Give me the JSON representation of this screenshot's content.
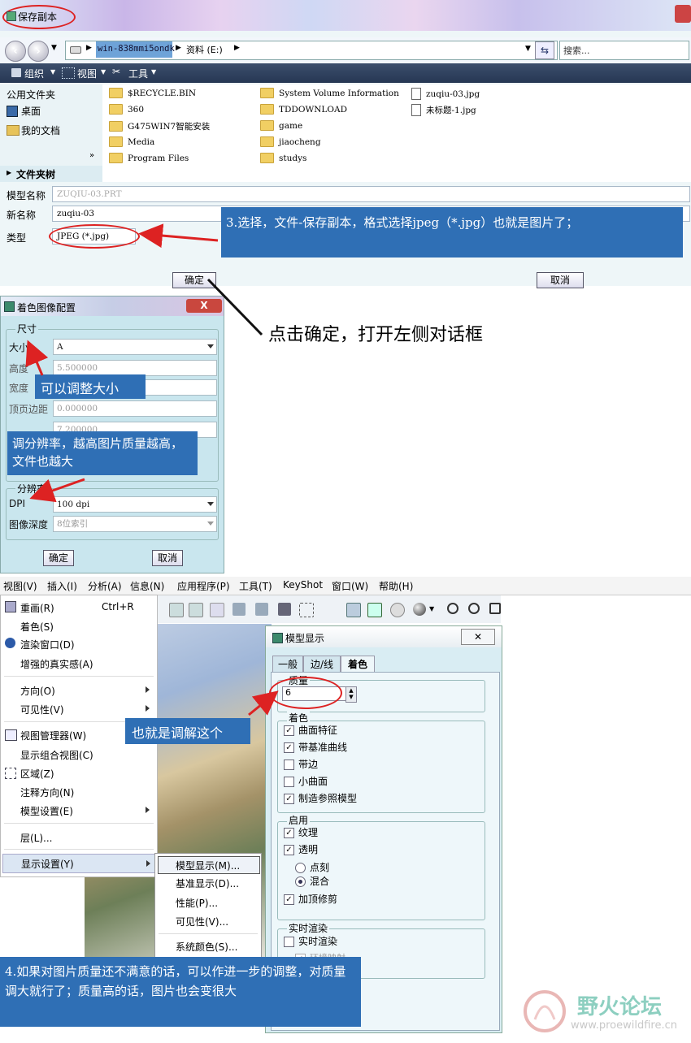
{
  "save_dialog": {
    "title": "保存副本",
    "address_host": "win-838mmi5ondk",
    "address_path": "资料 (E:)",
    "search_placeholder": "搜索...",
    "toolbar": {
      "organize": "组织",
      "view": "视图",
      "tools": "工具"
    },
    "left_pane": {
      "header": "公用文件夹",
      "items": [
        "桌面",
        "我的文档"
      ],
      "tree": "文件夹树"
    },
    "files": [
      {
        "name": "$RECYCLE.BIN",
        "kind": "folder"
      },
      {
        "name": "360",
        "kind": "folder"
      },
      {
        "name": "G475WIN7智能安装",
        "kind": "folder"
      },
      {
        "name": "Media",
        "kind": "folder"
      },
      {
        "name": "Program Files",
        "kind": "folder"
      },
      {
        "name": "System Volume Information",
        "kind": "folder"
      },
      {
        "name": "TDDOWNLOAD",
        "kind": "folder"
      },
      {
        "name": "game",
        "kind": "folder"
      },
      {
        "name": "jiaocheng",
        "kind": "folder"
      },
      {
        "name": "studys",
        "kind": "folder"
      },
      {
        "name": "zuqiu-03.jpg",
        "kind": "file"
      },
      {
        "name": "未标题-1.jpg",
        "kind": "file"
      }
    ],
    "fields": {
      "model_name_label": "模型名称",
      "model_name_value": "ZUQIU-03.PRT",
      "new_name_label": "新名称",
      "new_name_value": "zuqiu-03",
      "type_label": "类型",
      "type_value": "JPEG (*.jpg)"
    },
    "ok": "确定",
    "cancel": "取消"
  },
  "annotations": {
    "step3": "3.选择，文件-保存副本，格式选择jpeg（*.jpg）也就是图片了；",
    "click_ok": "点击确定，打开左侧对话框",
    "resize": "可以调整大小",
    "resolution": "调分辨率，越高图片质量越高，文件也越大",
    "adjust_this": "也就是调解这个",
    "step4": "4.如果对图片质量还不满意的话，可以作进一步的调整，对质量调大就行了；质量高的话，图片也会变很大"
  },
  "shade_dialog": {
    "title": "着色图像配置",
    "close": "X",
    "size_group": "尺寸",
    "size_label": "大小",
    "size_value": "A",
    "height_label": "高度",
    "height_value": "5.500000",
    "width_label": "宽度",
    "top_margin_label": "顶页边距",
    "top_margin_value": "0.000000",
    "fifth_value": "7.200000",
    "resolution_group": "分辨率",
    "dpi_label": "DPI",
    "dpi_value": "100 dpi",
    "depth_label": "图像深度",
    "depth_value": "8位索引",
    "ok": "确定",
    "cancel": "取消"
  },
  "menubar": [
    "视图(V)",
    "插入(I)",
    "分析(A)",
    "信息(N)",
    "应用程序(P)",
    "工具(T)",
    "KeyShot",
    "窗口(W)",
    "帮助(H)"
  ],
  "view_menu": {
    "items": [
      {
        "label": "重画(R)",
        "shortcut": "Ctrl+R"
      },
      {
        "label": "着色(S)"
      },
      {
        "label": "渲染窗口(D)"
      },
      {
        "label": "增强的真实感(A)"
      },
      {
        "label": "方向(O)"
      },
      {
        "label": "可见性(V)"
      },
      {
        "label": "视图管理器(W)"
      },
      {
        "label": "显示组合视图(C)"
      },
      {
        "label": "区域(Z)"
      },
      {
        "label": "注释方向(N)"
      },
      {
        "label": "模型设置(E)"
      },
      {
        "label": "层(L)..."
      },
      {
        "label": "显示设置(Y)"
      }
    ]
  },
  "display_submenu": [
    "模型显示(M)...",
    "基准显示(D)...",
    "性能(P)...",
    "可见性(V)...",
    "系统颜色(S)..."
  ],
  "model_display": {
    "title": "模型显示",
    "tabs": [
      "一般",
      "边/线",
      "着色"
    ],
    "quality_group": "质量",
    "quality_value": "6",
    "shading_group": "着色",
    "shading": [
      {
        "label": "曲面特征",
        "checked": true
      },
      {
        "label": "带基准曲线",
        "checked": true
      },
      {
        "label": "带边",
        "checked": false
      },
      {
        "label": "小曲面",
        "checked": false
      },
      {
        "label": "制造参照模型",
        "checked": true
      }
    ],
    "enable_group": "启用",
    "enable": [
      {
        "label": "纹理",
        "checked": true
      },
      {
        "label": "透明",
        "checked": true
      }
    ],
    "radios": [
      {
        "label": "点刻",
        "selected": false
      },
      {
        "label": "混合",
        "selected": true
      }
    ],
    "cap_label": "加顶修剪",
    "cap_checked": true,
    "realtime_group": "实时渲染",
    "realtime_label": "实时渲染",
    "reflection_label": "环境映射"
  },
  "watermark": {
    "title": "野火论坛",
    "url": "www.proewildfire.cn"
  }
}
